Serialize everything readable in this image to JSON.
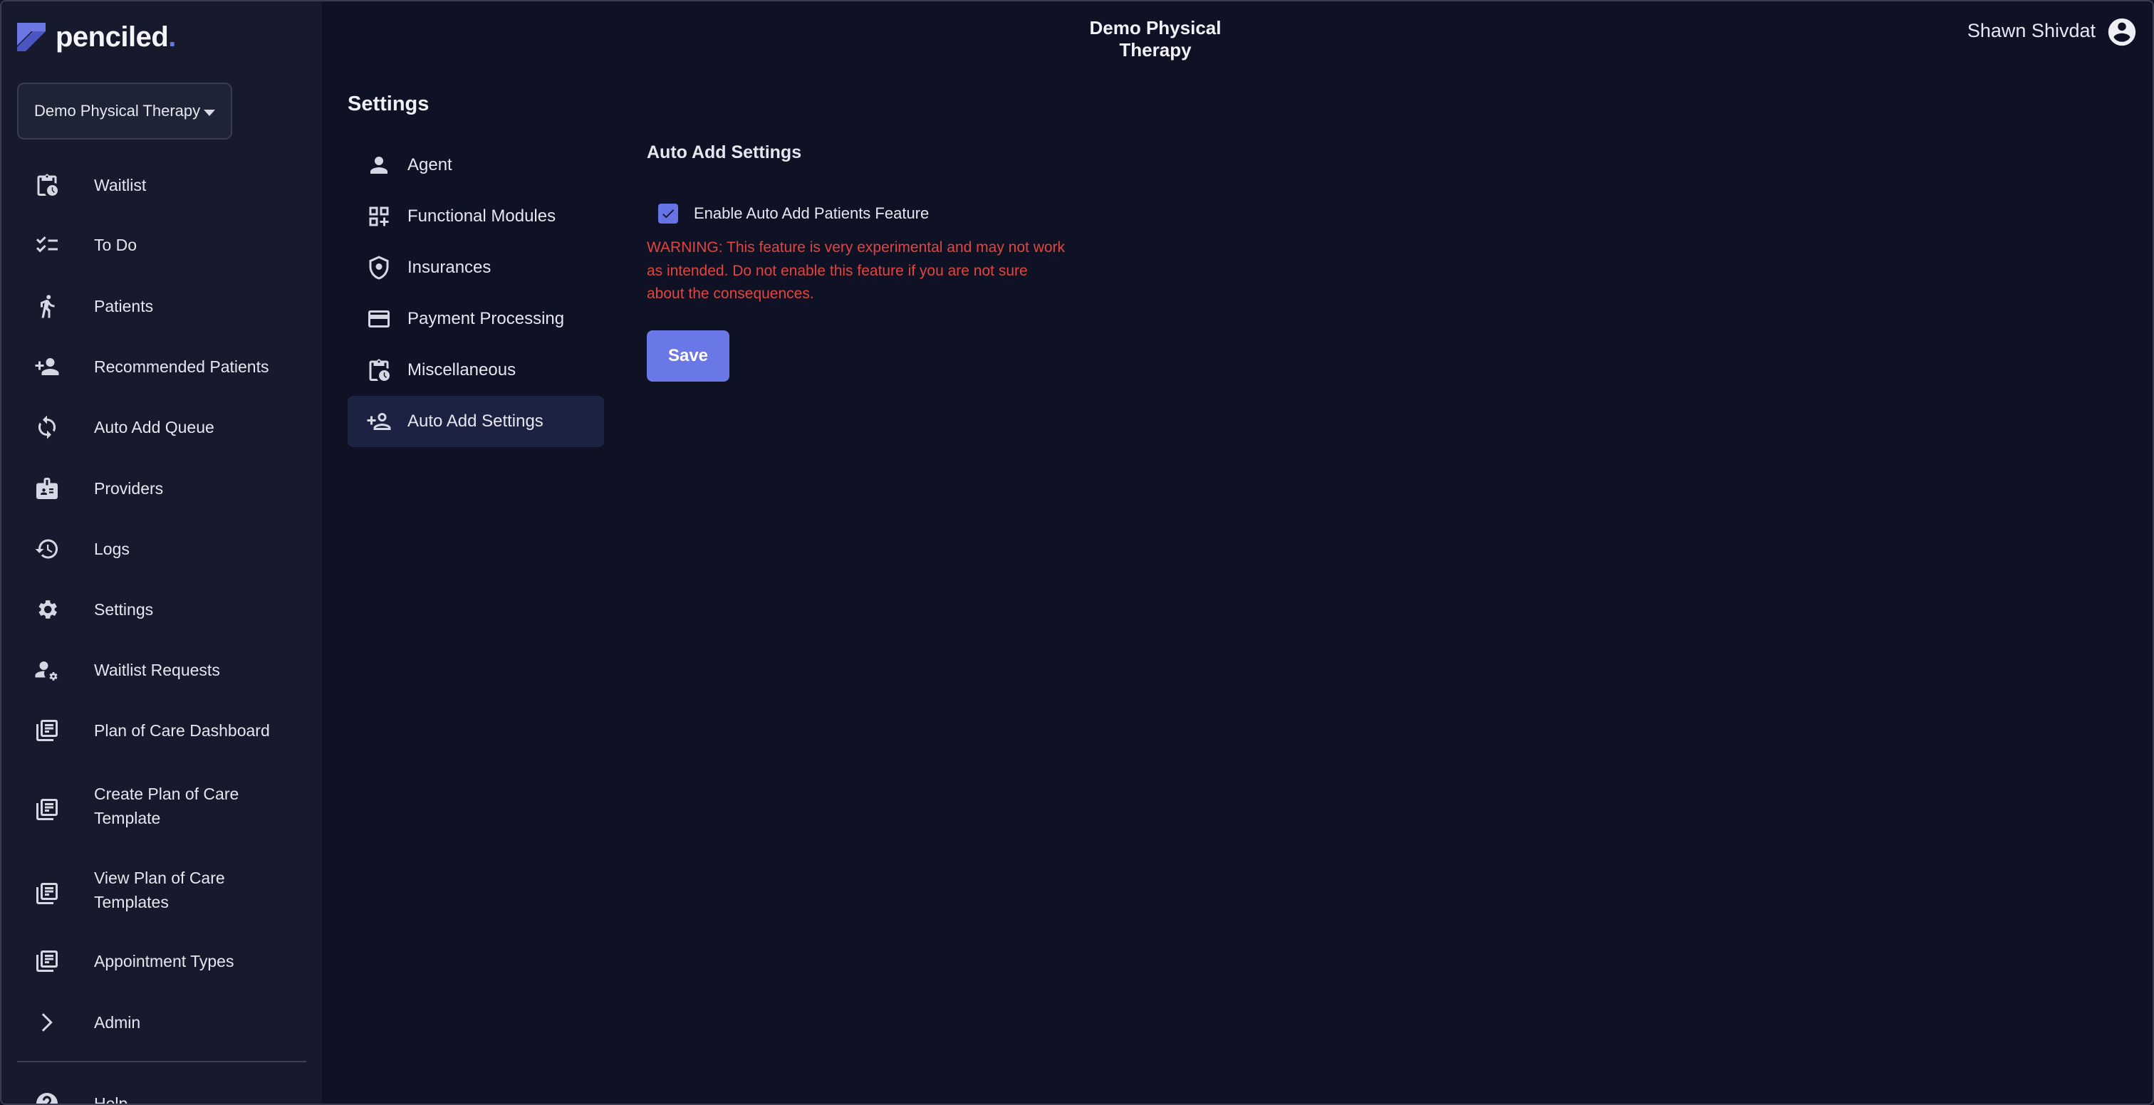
{
  "brand": {
    "name": "penciled",
    "dot": ".",
    "accent": "#6b77e3"
  },
  "header": {
    "title": "Demo Physical Therapy",
    "user_name": "Shawn Shivdat"
  },
  "sidebar": {
    "clinic_select": "Demo Physical Therapy",
    "items": [
      {
        "label": "Waitlist",
        "icon": "clipboard-clock-icon"
      },
      {
        "label": "To Do",
        "icon": "checklist-icon"
      },
      {
        "label": "Patients",
        "icon": "walking-person-icon"
      },
      {
        "label": "Recommended Patients",
        "icon": "person-add-icon"
      },
      {
        "label": "Auto Add Queue",
        "icon": "sync-icon"
      },
      {
        "label": "Providers",
        "icon": "badge-icon"
      },
      {
        "label": "Logs",
        "icon": "history-icon"
      },
      {
        "label": "Settings",
        "icon": "gear-icon"
      },
      {
        "label": "Waitlist Requests",
        "icon": "person-gear-icon"
      },
      {
        "label": "Plan of Care Dashboard",
        "icon": "library-books-icon"
      },
      {
        "label": "Create Plan of Care",
        "label2": "Template",
        "icon": "library-books-icon"
      },
      {
        "label": "View Plan of Care",
        "label2": "Templates",
        "icon": "library-books-icon"
      },
      {
        "label": "Appointment Types",
        "icon": "library-books-icon"
      },
      {
        "label": "Admin",
        "icon": "chevron-right-icon"
      },
      {
        "label": "Help",
        "icon": "help-icon"
      }
    ]
  },
  "settings": {
    "title": "Settings",
    "items": [
      {
        "label": "Agent",
        "icon": "person-icon"
      },
      {
        "label": "Functional Modules",
        "icon": "modules-icon"
      },
      {
        "label": "Insurances",
        "icon": "shield-icon"
      },
      {
        "label": "Payment Processing",
        "icon": "credit-card-icon"
      },
      {
        "label": "Miscellaneous",
        "icon": "clipboard-clock-icon"
      },
      {
        "label": "Auto Add Settings",
        "icon": "person-add-icon",
        "active": true
      }
    ]
  },
  "panel": {
    "title": "Auto Add Settings",
    "checkbox_label": "Enable Auto Add Patients Feature",
    "checkbox_checked": true,
    "warning_line1": "WARNING: This feature is very experimental and may not work",
    "warning_line2": "as intended. Do not enable this feature if you are not sure",
    "warning_line3": "about the consequences.",
    "save_label": "Save"
  },
  "colors": {
    "background": "#0f1225",
    "sidebar": "#161a2c",
    "primary": "#6a77e6",
    "warning": "#e2453f"
  }
}
